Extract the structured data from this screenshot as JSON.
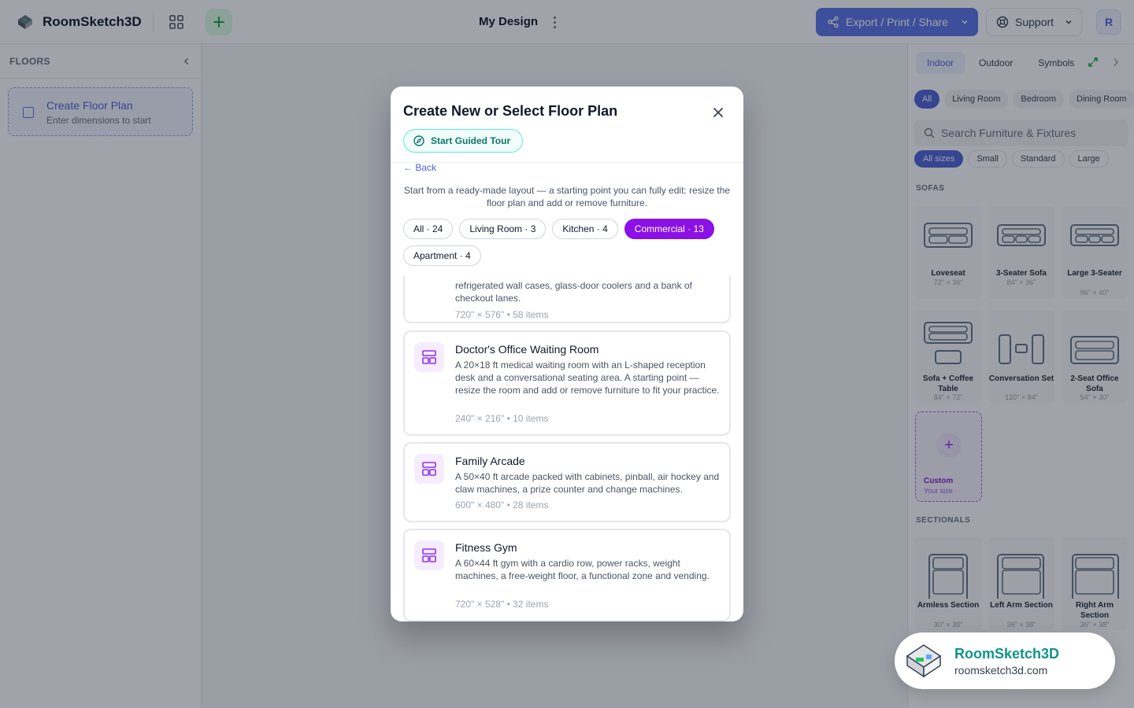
{
  "header": {
    "app_name": "RoomSketch3D",
    "design_title": "My Design",
    "export_label": "Export / Print / Share",
    "support_label": "Support",
    "avatar_initial": "R"
  },
  "sidebar": {
    "title": "FLOORS",
    "create_title": "Create Floor Plan",
    "create_subtitle": "Enter dimensions to start"
  },
  "right_panel": {
    "tabs": [
      "Indoor",
      "Outdoor",
      "Symbols"
    ],
    "active_tab": "Indoor",
    "room_chips": [
      "All",
      "Living Room",
      "Bedroom",
      "Dining Room"
    ],
    "search_placeholder": "Search Furniture & Fixtures",
    "size_chips": [
      "All sizes",
      "Small",
      "Standard",
      "Large"
    ],
    "sections": [
      "SOFAS",
      "SECTIONALS"
    ],
    "sofas": [
      {
        "name": "Loveseat",
        "dims": "72\" × 36\""
      },
      {
        "name": "3-Seater Sofa",
        "dims": "84\" × 36\""
      },
      {
        "name": "Large 3-Seater",
        "dims": "96\" × 40\""
      },
      {
        "name": "Sofa + Coffee Table",
        "dims": "84\" × 72\""
      },
      {
        "name": "Conversation Set",
        "dims": "120\" × 84\""
      },
      {
        "name": "2-Seat Office Sofa",
        "dims": "54\" × 30\""
      }
    ],
    "custom_title": "Custom",
    "custom_sub": "Your size",
    "sectionals": [
      {
        "name": "Armless Section",
        "dims": "30\" × 38\""
      },
      {
        "name": "Left Arm Section",
        "dims": "36\" × 38\""
      },
      {
        "name": "Right Arm Section",
        "dims": "36\" × 38\""
      }
    ]
  },
  "modal": {
    "title": "Create New or Select Floor Plan",
    "tour_label": "Start Guided Tour",
    "back_label": "← Back",
    "intro": "Start from a ready-made layout — a starting point you can fully edit: resize the floor plan and add or remove furniture.",
    "filters": [
      {
        "label": "All · 24",
        "active": false
      },
      {
        "label": "Living Room · 3",
        "active": false
      },
      {
        "label": "Kitchen · 4",
        "active": false
      },
      {
        "label": "Commercial · 13",
        "active": true
      },
      {
        "label": "Apartment · 4",
        "active": false
      }
    ],
    "cards": [
      {
        "title": "",
        "desc": "refrigerated wall cases, glass-door coolers and a bank of checkout lanes.",
        "meta": "720\" × 576\" • 58 items"
      },
      {
        "title": "Doctor's Office Waiting Room",
        "desc": "A 20×18 ft medical waiting room with an L-shaped reception desk and a conversational seating area. A starting point — resize the room and add or remove furniture to fit your practice.",
        "meta": "240\" × 216\" • 10 items"
      },
      {
        "title": "Family Arcade",
        "desc": "A 50×40 ft arcade packed with cabinets, pinball, air hockey and claw machines, a prize counter and change machines.",
        "meta": "600\" × 480\" • 28 items"
      },
      {
        "title": "Fitness Gym",
        "desc": "A 60×44 ft gym with a cardio row, power racks, weight machines, a free-weight floor, a functional zone and vending.",
        "meta": "720\" × 528\" • 32 items"
      }
    ]
  },
  "badge": {
    "name": "RoomSketch3D",
    "url": "roomsketch3d.com"
  },
  "colors": {
    "accent": "#4f63d8",
    "commercial_active": "#8b11e6",
    "tour_teal": "#0f766e"
  }
}
